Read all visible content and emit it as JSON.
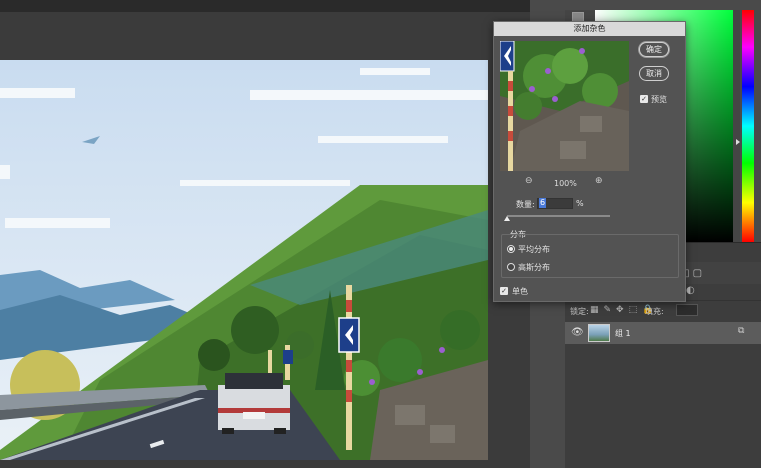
{
  "dialog": {
    "title": "添加杂色",
    "ok_label": "确定",
    "cancel_label": "取消",
    "preview_label": "预览",
    "preview_checked": true,
    "zoom_level": "100%",
    "amount_label": "数量:",
    "amount_value": "6",
    "amount_unit": "%",
    "distribution_label": "分布",
    "dist_uniform_label": "平均分布",
    "dist_gaussian_label": "高斯分布",
    "selected_distribution": "uniform",
    "monochromatic_label": "单色",
    "monochromatic_checked": true
  },
  "layers": {
    "lock_label": "锁定:",
    "fill_label": "填充:",
    "layer_name": "组 1"
  },
  "icons": {
    "zoom_out": "zoom-out-icon",
    "zoom_in": "zoom-in-icon",
    "eye": "eye-icon",
    "link": "link-icon"
  },
  "colors": {
    "dialog_bg": "#535353",
    "titlebar": "#d9d9d9",
    "accent_selection": "#4a7ad9"
  }
}
